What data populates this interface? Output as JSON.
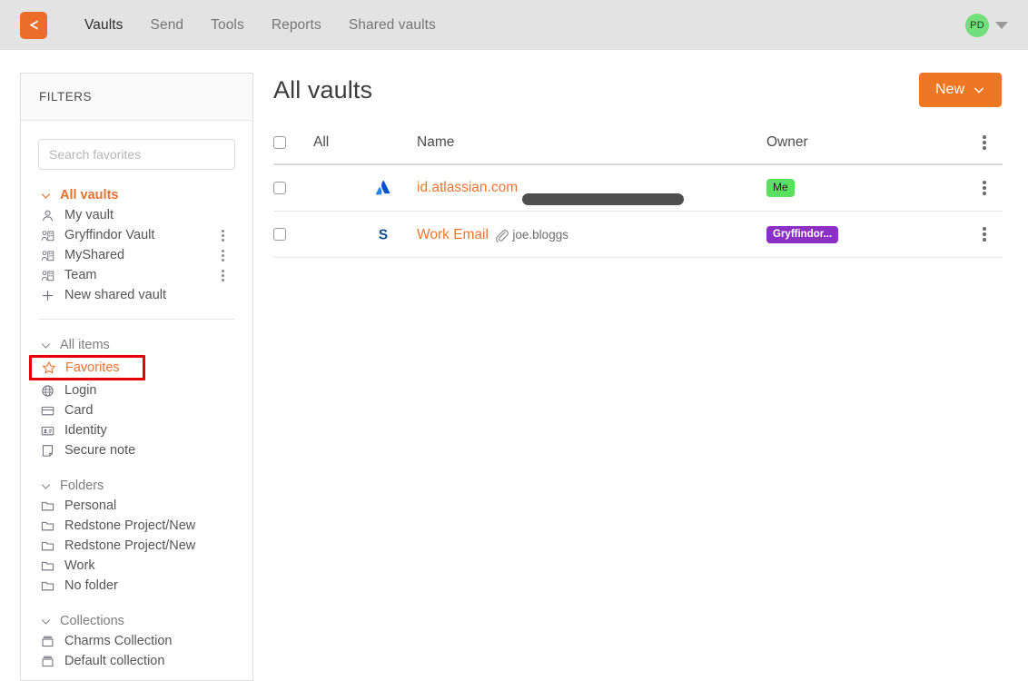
{
  "topnav": {
    "logo_name": "bitwarden-shield-logo",
    "links": [
      {
        "label": "Vaults",
        "active": true
      },
      {
        "label": "Send",
        "active": false
      },
      {
        "label": "Tools",
        "active": false
      },
      {
        "label": "Reports",
        "active": false
      },
      {
        "label": "Shared vaults",
        "active": false
      }
    ],
    "avatar_initials": "PD",
    "avatar_color": "#72e07a"
  },
  "sidebar": {
    "title": "FILTERS",
    "search_placeholder": "Search favorites",
    "search_value": "",
    "vaults_group": {
      "label": "All vaults",
      "items": [
        {
          "label": "My vault",
          "icon": "person-icon",
          "kebab": false
        },
        {
          "label": "Gryffindor Vault",
          "icon": "organization-icon",
          "kebab": true
        },
        {
          "label": "MyShared",
          "icon": "organization-icon",
          "kebab": true
        },
        {
          "label": "Team",
          "icon": "organization-icon",
          "kebab": true
        },
        {
          "label": "New shared vault",
          "icon": "plus-icon",
          "kebab": false
        }
      ]
    },
    "items_group": {
      "label": "All items",
      "items": [
        {
          "label": "Favorites",
          "icon": "star-icon",
          "highlighted": true
        },
        {
          "label": "Login",
          "icon": "globe-icon",
          "highlighted": false
        },
        {
          "label": "Card",
          "icon": "card-icon",
          "highlighted": false
        },
        {
          "label": "Identity",
          "icon": "identity-icon",
          "highlighted": false
        },
        {
          "label": "Secure note",
          "icon": "note-icon",
          "highlighted": false
        }
      ]
    },
    "folders_group": {
      "label": "Folders",
      "items": [
        {
          "label": "Personal",
          "icon": "folder-icon"
        },
        {
          "label": "Redstone Project/New",
          "icon": "folder-icon"
        },
        {
          "label": "Redstone Project/New",
          "icon": "folder-icon"
        },
        {
          "label": "Work",
          "icon": "folder-icon"
        },
        {
          "label": "No folder",
          "icon": "folder-icon"
        }
      ]
    },
    "collections_group": {
      "label": "Collections",
      "items": [
        {
          "label": "Charms Collection",
          "icon": "collection-icon"
        },
        {
          "label": "Default collection",
          "icon": "collection-icon"
        }
      ]
    }
  },
  "main": {
    "page_title": "All vaults",
    "new_button_label": "New",
    "table": {
      "headers": {
        "all": "All",
        "name": "Name",
        "owner": "Owner"
      },
      "rows": [
        {
          "name": "id.atlassian.com",
          "sub": "",
          "sub_redacted": true,
          "icon": "atlassian-icon",
          "attachment": false,
          "owner": "Me",
          "owner_type": "me"
        },
        {
          "name": "Work Email",
          "sub": "joe.bloggs",
          "sub_redacted": false,
          "icon": "skype-icon",
          "attachment": true,
          "owner": "Gryffindor...",
          "owner_type": "org"
        }
      ]
    }
  },
  "colors": {
    "brand_orange": "#ef7622",
    "link_orange": "#ef7430",
    "highlight_red": "#e60000",
    "badge_me_green": "#5ae05f",
    "badge_org_purple": "#8c2fc4"
  }
}
